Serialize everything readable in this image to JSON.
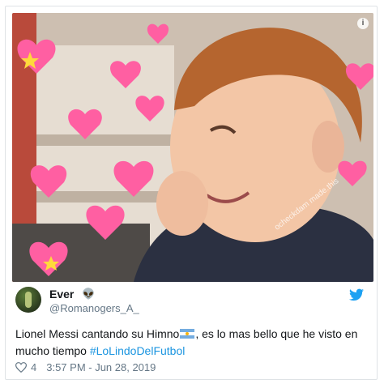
{
  "media": {
    "watermark": "ocheckdam made.this",
    "info_icon": "i"
  },
  "tweet": {
    "display_name": "Ever",
    "display_name_emoji": "👽",
    "handle": "@Romanogers_A_",
    "text_part1": "Lionel Messi cantando su Himno",
    "flag_icon": "argentina-flag",
    "text_part2": ", es lo mas bello que he visto en mucho tiempo ",
    "hashtag": "#LoLindoDelFutbol",
    "likes": "4",
    "timestamp": "3:57 PM - Jun 28, 2019"
  },
  "colors": {
    "link": "#1b95e0",
    "twitter_blue": "#1da1f2",
    "heart_pink": "#ff5fa2"
  }
}
